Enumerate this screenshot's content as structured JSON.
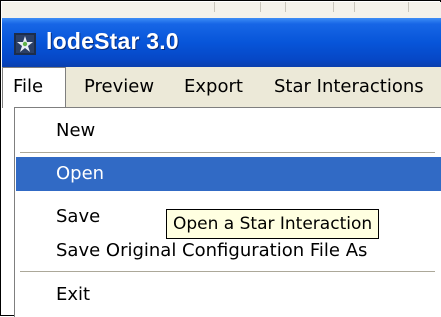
{
  "window": {
    "title": "lodeStar 3.0",
    "icon": "lodestar-app-icon"
  },
  "menubar": {
    "items": [
      {
        "label": "File",
        "state": "open"
      },
      {
        "label": "Preview"
      },
      {
        "label": "Export"
      },
      {
        "label": "Star Interactions"
      }
    ]
  },
  "file_menu": {
    "items": [
      {
        "label": "New"
      },
      {
        "label": "Open",
        "highlighted": true
      },
      {
        "label": "Save"
      },
      {
        "label": "Save Original Configuration File As"
      },
      {
        "label": "Exit"
      }
    ]
  },
  "tooltip": {
    "text": "Open a Star Interaction"
  },
  "colors": {
    "titlebar": "#0755d9",
    "menu_highlight": "#316ac5",
    "tooltip_bg": "#ffffe1",
    "menubar_bg": "#ece9d8"
  }
}
